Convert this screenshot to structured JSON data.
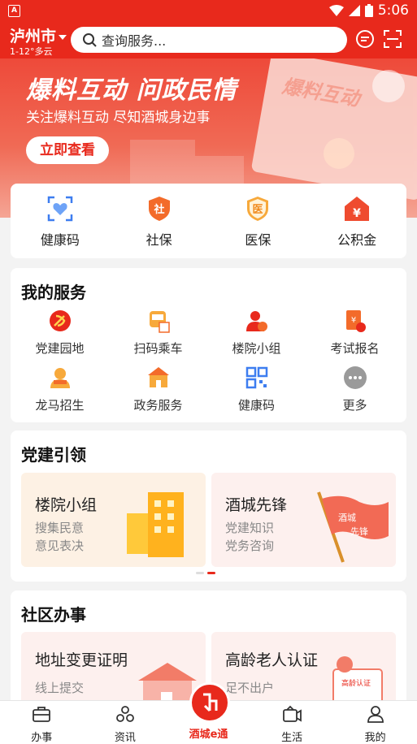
{
  "status": {
    "time": "5:06"
  },
  "header": {
    "city": "泸州市",
    "weather": "1-12°多云",
    "search_placeholder": "查询服务..."
  },
  "banner": {
    "title": "爆料互动 问政民情",
    "subtitle": "关注爆料互动 尽知酒城身边事",
    "button": "立即查看",
    "paper_text": "爆料互动"
  },
  "quick": [
    {
      "label": "健康码",
      "icon": "health-code-icon"
    },
    {
      "label": "社保",
      "icon": "social-security-icon"
    },
    {
      "label": "医保",
      "icon": "medical-insurance-icon"
    },
    {
      "label": "公积金",
      "icon": "housing-fund-icon"
    }
  ],
  "services": {
    "title": "我的服务",
    "items": [
      {
        "label": "党建园地",
        "icon": "party-icon"
      },
      {
        "label": "扫码乘车",
        "icon": "bus-icon"
      },
      {
        "label": "楼院小组",
        "icon": "group-icon"
      },
      {
        "label": "考试报名",
        "icon": "exam-icon"
      },
      {
        "label": "龙马招生",
        "icon": "enroll-icon"
      },
      {
        "label": "政务服务",
        "icon": "government-icon"
      },
      {
        "label": "健康码",
        "icon": "qr-icon"
      },
      {
        "label": "更多",
        "icon": "more-icon"
      }
    ]
  },
  "party": {
    "title": "党建引领",
    "tiles": [
      {
        "title": "楼院小组",
        "line1": "搜集民意",
        "line2": "意见表决"
      },
      {
        "title": "酒城先锋",
        "line1": "党建知识",
        "line2": "党务咨询",
        "flag1": "酒城",
        "flag2": "先锋"
      }
    ]
  },
  "community": {
    "title": "社区办事",
    "tiles": [
      {
        "title": "地址变更证明",
        "line1": "线上提交"
      },
      {
        "title": "高龄老人认证",
        "line1": "足不出户",
        "stamp": "高龄认证"
      }
    ]
  },
  "tabs": [
    {
      "label": "办事",
      "icon": "briefcase-icon"
    },
    {
      "label": "资讯",
      "icon": "news-icon"
    },
    {
      "label": "酒城e通",
      "icon": "app-logo-icon"
    },
    {
      "label": "生活",
      "icon": "life-icon"
    },
    {
      "label": "我的",
      "icon": "user-icon"
    }
  ],
  "colors": {
    "brand": "#e8291c",
    "accent_orange": "#f36b2a"
  }
}
